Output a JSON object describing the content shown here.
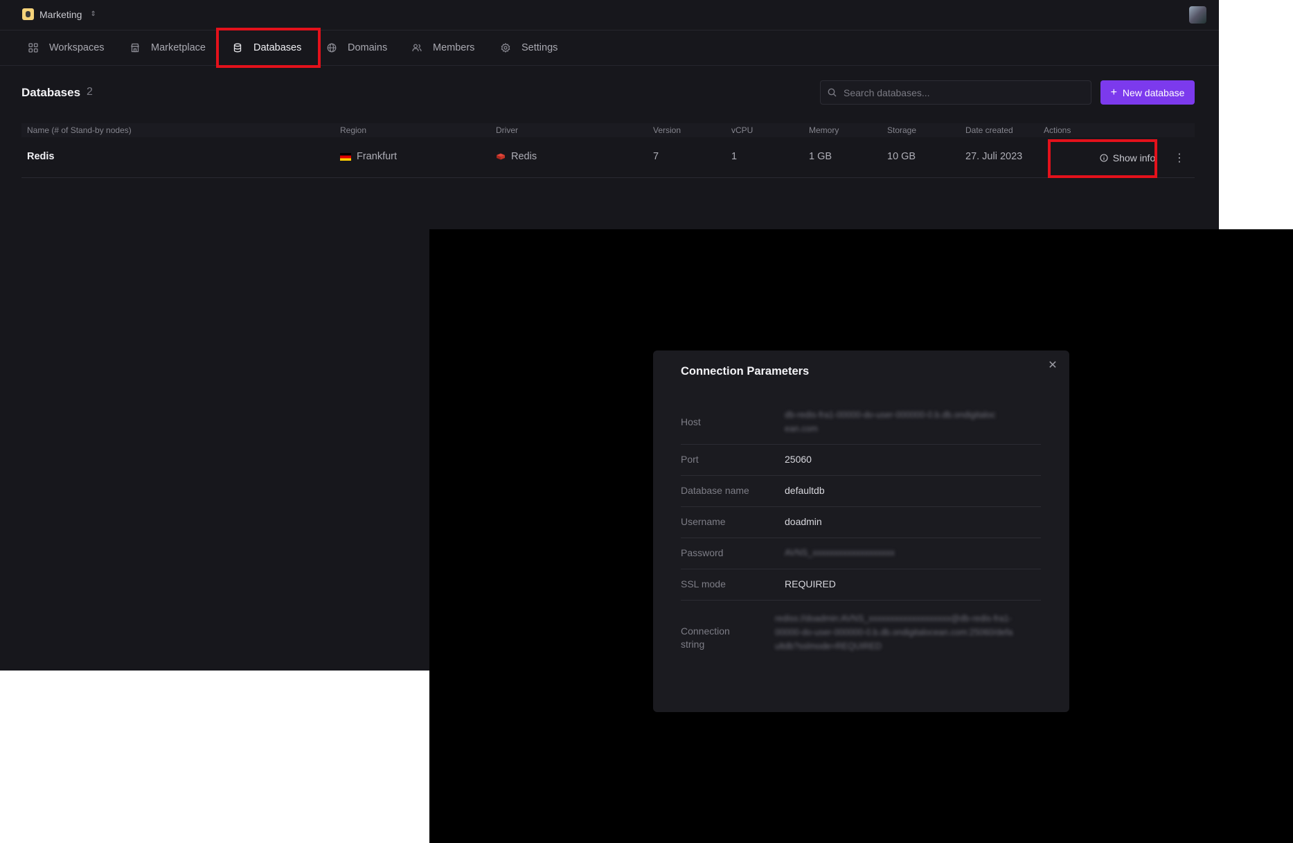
{
  "workspace": {
    "name": "Marketing"
  },
  "nav": {
    "items": [
      {
        "label": "Workspaces"
      },
      {
        "label": "Marketplace"
      },
      {
        "label": "Databases"
      },
      {
        "label": "Domains"
      },
      {
        "label": "Members"
      },
      {
        "label": "Settings"
      }
    ],
    "active": "Databases"
  },
  "page": {
    "title": "Databases",
    "count": "2",
    "search_placeholder": "Search databases...",
    "new_button_label": "New database"
  },
  "table": {
    "columns": [
      "Name (# of Stand-by nodes)",
      "Region",
      "Driver",
      "Version",
      "vCPU",
      "Memory",
      "Storage",
      "Date created",
      "Actions"
    ],
    "rows": [
      {
        "name": "Redis",
        "region": "Frankfurt",
        "driver": "Redis",
        "version": "7",
        "vcpu": "1",
        "memory": "1 GB",
        "storage": "10 GB",
        "date_created": "27. Juli 2023",
        "action_label": "Show info"
      }
    ]
  },
  "modal": {
    "title": "Connection Parameters",
    "params": [
      {
        "label": "Host",
        "value": "db-redis-fra1-00000-do-user-000000-0.b.db.ondigitalocean.com",
        "obscured": true
      },
      {
        "label": "Port",
        "value": "25060",
        "obscured": false
      },
      {
        "label": "Database name",
        "value": "defaultdb",
        "obscured": false
      },
      {
        "label": "Username",
        "value": "doadmin",
        "obscured": false
      },
      {
        "label": "Password",
        "value": "AVNS_xxxxxxxxxxxxxxxxxxx",
        "obscured": true
      },
      {
        "label": "SSL mode",
        "value": "REQUIRED",
        "obscured": false
      },
      {
        "label": "Connection string",
        "value": "rediss://doadmin:AVNS_xxxxxxxxxxxxxxxxxxx@db-redis-fra1-00000-do-user-000000-0.b.db.ondigitalocean.com:25060/defaultdb?sslmode=REQUIRED",
        "obscured": true
      }
    ]
  },
  "colors": {
    "accent": "#7c3aed",
    "highlight": "#e3111b",
    "background": "#17171c",
    "overlay": "#000000"
  }
}
